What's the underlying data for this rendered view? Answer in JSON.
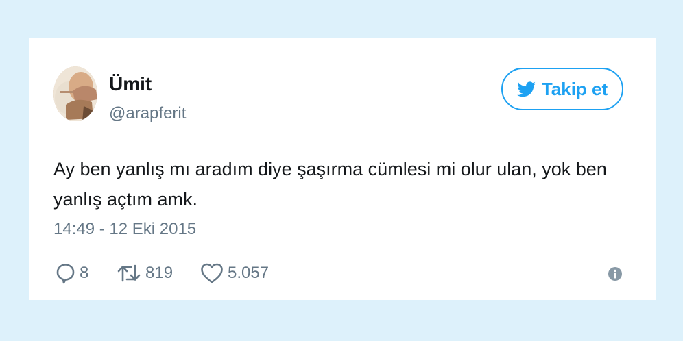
{
  "tweet": {
    "author_name": "Ümit",
    "author_handle": "@arapferit",
    "follow_label": "Takip et",
    "text": "Ay ben yanlış mı aradım diye şaşırma cümlesi mi olur ulan, yok ben yanlış açtım amk.",
    "timestamp": "14:49 - 12 Eki 2015",
    "replies": "8",
    "retweets": "819",
    "likes": "5.057"
  },
  "colors": {
    "page_background": "#ddf1fb",
    "card_background": "#ffffff",
    "twitter_blue": "#1da1f2",
    "primary_text": "#14171a",
    "secondary_text": "#657786"
  },
  "icons": {
    "follow": "twitter-bird-icon",
    "reply": "reply-icon",
    "retweet": "retweet-icon",
    "like": "heart-icon",
    "info": "info-icon"
  }
}
